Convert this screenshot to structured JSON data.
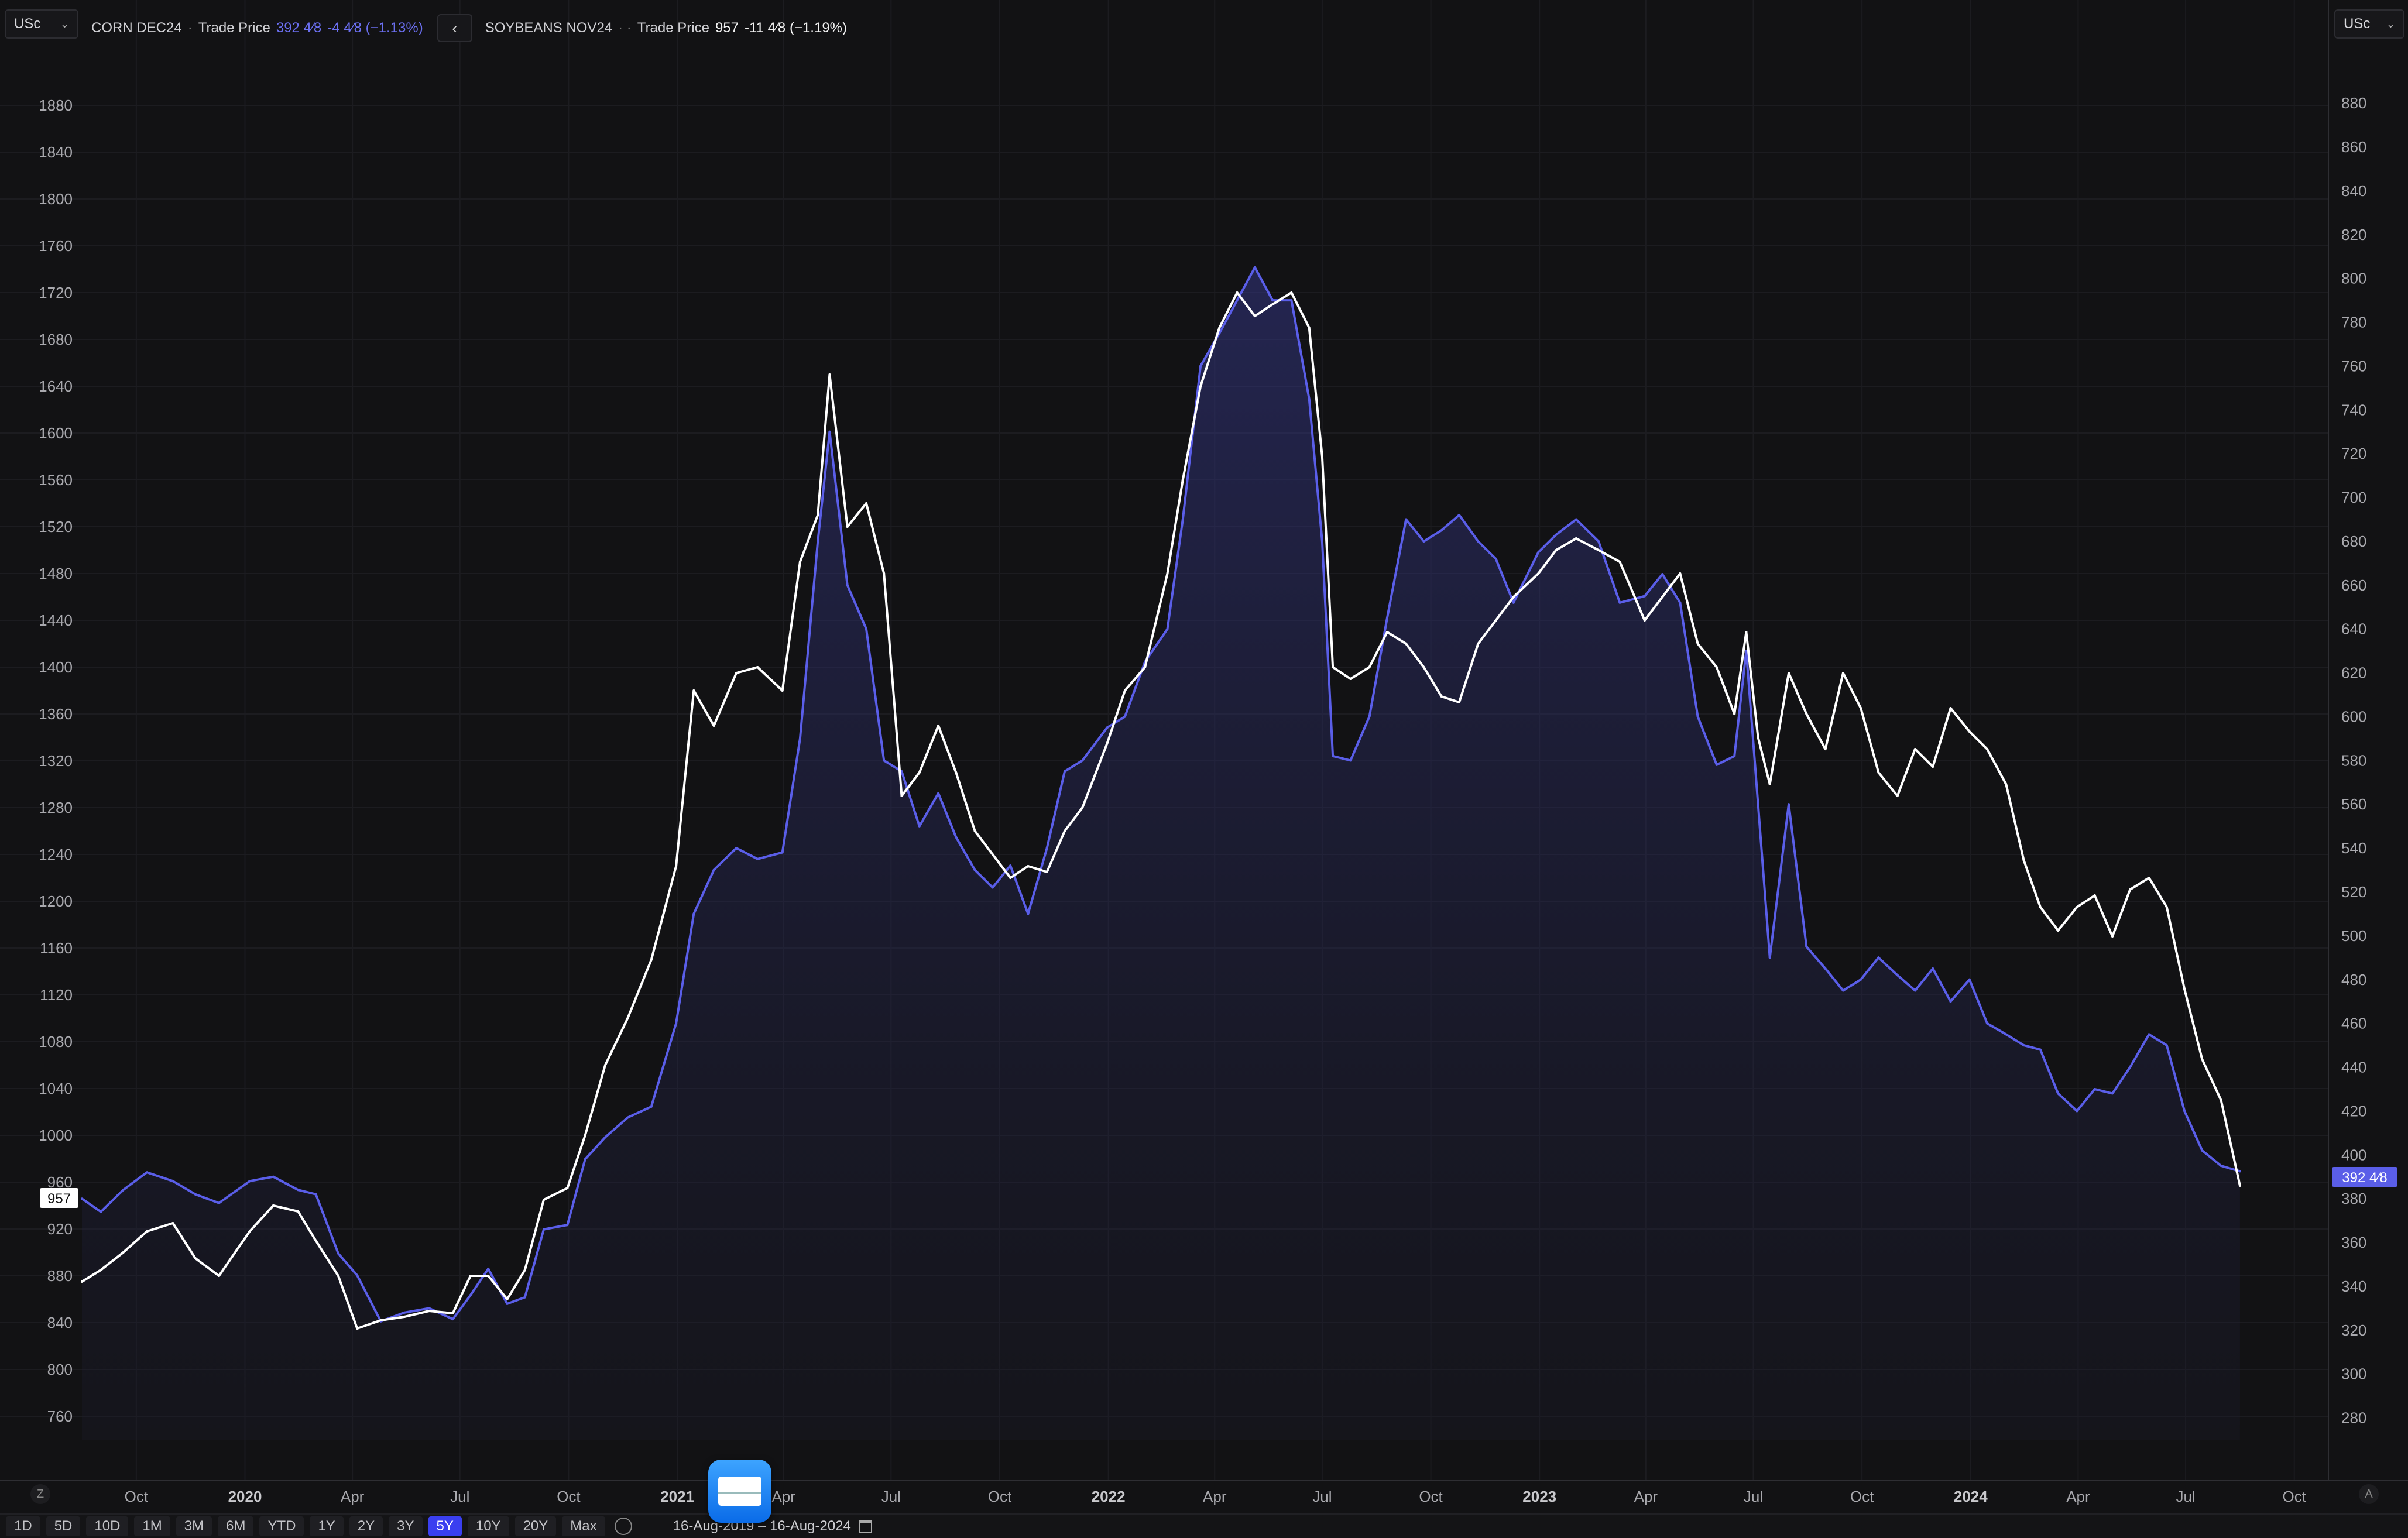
{
  "header": {
    "currency_left": "USc",
    "currency_right": "USc",
    "series1": {
      "name": "CORN DEC24",
      "sep": "·",
      "label": "Trade Price",
      "price": "392 4⁄8",
      "change": "-4 4⁄8 (−1.13%)"
    },
    "series2": {
      "name": "SOYBEANS NOV24",
      "sep": "· ·",
      "label": "Trade Price",
      "price": "957",
      "change": "-11 4⁄8 (−1.19%)"
    }
  },
  "price_tags": {
    "soy": "957",
    "corn": "392 4⁄8"
  },
  "bottom": {
    "ranges": [
      "1D",
      "5D",
      "10D",
      "1M",
      "3M",
      "6M",
      "YTD",
      "1Y",
      "2Y",
      "3Y",
      "5Y",
      "10Y",
      "20Y",
      "Max"
    ],
    "active_range": "5Y",
    "date_range": "16-Aug-2019  –  16-Aug-2024",
    "z_label": "Z",
    "a_label": "A"
  },
  "colors": {
    "corn": "#5a5ee8",
    "soy": "#ffffff",
    "active": "#3a3ff0"
  },
  "chart_data": {
    "type": "line",
    "title": "",
    "x_tick_labels": [
      "Oct",
      "2020",
      "Apr",
      "Jul",
      "Oct",
      "2021",
      "Apr",
      "Jul",
      "Oct",
      "2022",
      "Apr",
      "Jul",
      "Oct",
      "2023",
      "Apr",
      "Jul",
      "Oct",
      "2024",
      "Apr",
      "Jul",
      "Oct"
    ],
    "x_tick_dates": [
      "2019-10-01",
      "2020-01-01",
      "2020-04-01",
      "2020-07-01",
      "2020-10-01",
      "2021-01-01",
      "2021-04-01",
      "2021-07-01",
      "2021-10-01",
      "2022-01-01",
      "2022-04-01",
      "2022-07-01",
      "2022-10-01",
      "2023-01-01",
      "2023-04-01",
      "2023-07-01",
      "2023-10-01",
      "2024-01-01",
      "2024-04-01",
      "2024-07-01",
      "2024-10-01"
    ],
    "xlim": [
      "2019-08-16",
      "2024-10-16"
    ],
    "left_axis": {
      "series": "SOYBEANS NOV24",
      "ylim": [
        740,
        1910
      ],
      "ticks": [
        760,
        800,
        840,
        880,
        920,
        960,
        1000,
        1040,
        1080,
        1120,
        1160,
        1200,
        1240,
        1280,
        1320,
        1360,
        1400,
        1440,
        1480,
        1520,
        1560,
        1600,
        1640,
        1680,
        1720,
        1760,
        1800,
        1840,
        1880
      ]
    },
    "right_axis": {
      "series": "CORN DEC24",
      "ylim": [
        270,
        895
      ],
      "ticks": [
        280,
        300,
        320,
        340,
        360,
        380,
        400,
        420,
        440,
        460,
        480,
        500,
        520,
        540,
        560,
        580,
        600,
        620,
        640,
        660,
        680,
        700,
        720,
        740,
        760,
        780,
        800,
        820,
        840,
        860,
        880
      ]
    },
    "series": [
      {
        "name": "CORN DEC24",
        "axis": "right",
        "color": "#5a5ee8",
        "fill": true,
        "points": [
          [
            "2019-08-16",
            380
          ],
          [
            "2019-09-01",
            374
          ],
          [
            "2019-09-20",
            384
          ],
          [
            "2019-10-10",
            392
          ],
          [
            "2019-11-01",
            388
          ],
          [
            "2019-11-20",
            382
          ],
          [
            "2019-12-10",
            378
          ],
          [
            "2020-01-05",
            388
          ],
          [
            "2020-01-25",
            390
          ],
          [
            "2020-02-15",
            384
          ],
          [
            "2020-03-01",
            382
          ],
          [
            "2020-03-20",
            355
          ],
          [
            "2020-04-05",
            345
          ],
          [
            "2020-04-25",
            324
          ],
          [
            "2020-05-15",
            328
          ],
          [
            "2020-06-05",
            330
          ],
          [
            "2020-06-25",
            325
          ],
          [
            "2020-07-10",
            336
          ],
          [
            "2020-07-25",
            348
          ],
          [
            "2020-08-10",
            332
          ],
          [
            "2020-08-25",
            335
          ],
          [
            "2020-09-10",
            366
          ],
          [
            "2020-09-30",
            368
          ],
          [
            "2020-10-15",
            398
          ],
          [
            "2020-11-01",
            408
          ],
          [
            "2020-11-20",
            417
          ],
          [
            "2020-12-10",
            422
          ],
          [
            "2020-12-31",
            460
          ],
          [
            "2021-01-15",
            510
          ],
          [
            "2021-02-01",
            530
          ],
          [
            "2021-02-20",
            540
          ],
          [
            "2021-03-10",
            535
          ],
          [
            "2021-03-31",
            538
          ],
          [
            "2021-04-15",
            590
          ],
          [
            "2021-04-30",
            680
          ],
          [
            "2021-05-10",
            730
          ],
          [
            "2021-05-25",
            660
          ],
          [
            "2021-06-10",
            640
          ],
          [
            "2021-06-25",
            580
          ],
          [
            "2021-07-10",
            575
          ],
          [
            "2021-07-25",
            550
          ],
          [
            "2021-08-10",
            565
          ],
          [
            "2021-08-25",
            545
          ],
          [
            "2021-09-10",
            530
          ],
          [
            "2021-09-25",
            522
          ],
          [
            "2021-10-10",
            532
          ],
          [
            "2021-10-25",
            510
          ],
          [
            "2021-11-10",
            540
          ],
          [
            "2021-11-25",
            575
          ],
          [
            "2021-12-10",
            580
          ],
          [
            "2021-12-31",
            595
          ],
          [
            "2022-01-15",
            600
          ],
          [
            "2022-02-01",
            625
          ],
          [
            "2022-02-20",
            640
          ],
          [
            "2022-03-05",
            690
          ],
          [
            "2022-03-20",
            760
          ],
          [
            "2022-04-05",
            775
          ],
          [
            "2022-04-20",
            790
          ],
          [
            "2022-05-05",
            805
          ],
          [
            "2022-05-20",
            790
          ],
          [
            "2022-06-05",
            790
          ],
          [
            "2022-06-20",
            745
          ],
          [
            "2022-07-01",
            680
          ],
          [
            "2022-07-10",
            582
          ],
          [
            "2022-07-25",
            580
          ],
          [
            "2022-08-10",
            600
          ],
          [
            "2022-08-25",
            645
          ],
          [
            "2022-09-10",
            690
          ],
          [
            "2022-09-25",
            680
          ],
          [
            "2022-10-10",
            685
          ],
          [
            "2022-10-25",
            692
          ],
          [
            "2022-11-10",
            680
          ],
          [
            "2022-11-25",
            672
          ],
          [
            "2022-12-10",
            652
          ],
          [
            "2022-12-31",
            675
          ],
          [
            "2023-01-15",
            683
          ],
          [
            "2023-02-01",
            690
          ],
          [
            "2023-02-20",
            680
          ],
          [
            "2023-03-10",
            652
          ],
          [
            "2023-03-31",
            655
          ],
          [
            "2023-04-15",
            665
          ],
          [
            "2023-04-30",
            652
          ],
          [
            "2023-05-15",
            600
          ],
          [
            "2023-05-31",
            578
          ],
          [
            "2023-06-15",
            582
          ],
          [
            "2023-06-25",
            630
          ],
          [
            "2023-07-05",
            560
          ],
          [
            "2023-07-15",
            490
          ],
          [
            "2023-07-31",
            560
          ],
          [
            "2023-08-15",
            495
          ],
          [
            "2023-08-31",
            485
          ],
          [
            "2023-09-15",
            475
          ],
          [
            "2023-09-30",
            480
          ],
          [
            "2023-10-15",
            490
          ],
          [
            "2023-10-31",
            482
          ],
          [
            "2023-11-15",
            475
          ],
          [
            "2023-11-30",
            485
          ],
          [
            "2023-12-15",
            470
          ],
          [
            "2023-12-31",
            480
          ],
          [
            "2024-01-15",
            460
          ],
          [
            "2024-01-31",
            455
          ],
          [
            "2024-02-15",
            450
          ],
          [
            "2024-02-29",
            448
          ],
          [
            "2024-03-15",
            428
          ],
          [
            "2024-03-31",
            420
          ],
          [
            "2024-04-15",
            430
          ],
          [
            "2024-04-30",
            428
          ],
          [
            "2024-05-15",
            440
          ],
          [
            "2024-05-31",
            455
          ],
          [
            "2024-06-15",
            450
          ],
          [
            "2024-06-30",
            420
          ],
          [
            "2024-07-15",
            402
          ],
          [
            "2024-07-31",
            395
          ],
          [
            "2024-08-16",
            392.5
          ]
        ]
      },
      {
        "name": "SOYBEANS NOV24",
        "axis": "left",
        "color": "#ffffff",
        "fill": false,
        "points": [
          [
            "2019-08-16",
            875
          ],
          [
            "2019-09-01",
            885
          ],
          [
            "2019-09-20",
            900
          ],
          [
            "2019-10-10",
            918
          ],
          [
            "2019-11-01",
            925
          ],
          [
            "2019-11-20",
            895
          ],
          [
            "2019-12-10",
            880
          ],
          [
            "2020-01-05",
            918
          ],
          [
            "2020-01-25",
            940
          ],
          [
            "2020-02-15",
            935
          ],
          [
            "2020-03-01",
            910
          ],
          [
            "2020-03-20",
            880
          ],
          [
            "2020-04-05",
            835
          ],
          [
            "2020-04-25",
            842
          ],
          [
            "2020-05-15",
            845
          ],
          [
            "2020-06-05",
            850
          ],
          [
            "2020-06-25",
            848
          ],
          [
            "2020-07-10",
            880
          ],
          [
            "2020-07-25",
            880
          ],
          [
            "2020-08-10",
            860
          ],
          [
            "2020-08-25",
            885
          ],
          [
            "2020-09-10",
            945
          ],
          [
            "2020-09-30",
            955
          ],
          [
            "2020-10-15",
            1000
          ],
          [
            "2020-11-01",
            1060
          ],
          [
            "2020-11-20",
            1100
          ],
          [
            "2020-12-10",
            1150
          ],
          [
            "2020-12-31",
            1230
          ],
          [
            "2021-01-15",
            1380
          ],
          [
            "2021-02-01",
            1350
          ],
          [
            "2021-02-20",
            1395
          ],
          [
            "2021-03-10",
            1400
          ],
          [
            "2021-03-31",
            1380
          ],
          [
            "2021-04-15",
            1490
          ],
          [
            "2021-04-30",
            1530
          ],
          [
            "2021-05-10",
            1650
          ],
          [
            "2021-05-25",
            1520
          ],
          [
            "2021-06-10",
            1540
          ],
          [
            "2021-06-25",
            1480
          ],
          [
            "2021-07-10",
            1290
          ],
          [
            "2021-07-25",
            1310
          ],
          [
            "2021-08-10",
            1350
          ],
          [
            "2021-08-25",
            1310
          ],
          [
            "2021-09-10",
            1260
          ],
          [
            "2021-09-25",
            1240
          ],
          [
            "2021-10-10",
            1220
          ],
          [
            "2021-10-25",
            1230
          ],
          [
            "2021-11-10",
            1225
          ],
          [
            "2021-11-25",
            1260
          ],
          [
            "2021-12-10",
            1280
          ],
          [
            "2021-12-31",
            1335
          ],
          [
            "2022-01-15",
            1380
          ],
          [
            "2022-02-01",
            1400
          ],
          [
            "2022-02-20",
            1480
          ],
          [
            "2022-03-05",
            1560
          ],
          [
            "2022-03-20",
            1640
          ],
          [
            "2022-04-05",
            1690
          ],
          [
            "2022-04-20",
            1720
          ],
          [
            "2022-05-05",
            1700
          ],
          [
            "2022-05-20",
            1710
          ],
          [
            "2022-06-05",
            1720
          ],
          [
            "2022-06-20",
            1690
          ],
          [
            "2022-07-01",
            1580
          ],
          [
            "2022-07-10",
            1400
          ],
          [
            "2022-07-25",
            1390
          ],
          [
            "2022-08-10",
            1400
          ],
          [
            "2022-08-25",
            1430
          ],
          [
            "2022-09-10",
            1420
          ],
          [
            "2022-09-25",
            1400
          ],
          [
            "2022-10-10",
            1375
          ],
          [
            "2022-10-25",
            1370
          ],
          [
            "2022-11-10",
            1420
          ],
          [
            "2022-11-25",
            1440
          ],
          [
            "2022-12-10",
            1460
          ],
          [
            "2022-12-31",
            1480
          ],
          [
            "2023-01-15",
            1500
          ],
          [
            "2023-02-01",
            1510
          ],
          [
            "2023-02-20",
            1500
          ],
          [
            "2023-03-10",
            1490
          ],
          [
            "2023-03-31",
            1440
          ],
          [
            "2023-04-15",
            1460
          ],
          [
            "2023-04-30",
            1480
          ],
          [
            "2023-05-15",
            1420
          ],
          [
            "2023-05-31",
            1400
          ],
          [
            "2023-06-15",
            1360
          ],
          [
            "2023-06-25",
            1430
          ],
          [
            "2023-07-05",
            1340
          ],
          [
            "2023-07-15",
            1300
          ],
          [
            "2023-07-31",
            1395
          ],
          [
            "2023-08-15",
            1360
          ],
          [
            "2023-08-31",
            1330
          ],
          [
            "2023-09-15",
            1395
          ],
          [
            "2023-09-30",
            1365
          ],
          [
            "2023-10-15",
            1310
          ],
          [
            "2023-10-31",
            1290
          ],
          [
            "2023-11-15",
            1330
          ],
          [
            "2023-11-30",
            1315
          ],
          [
            "2023-12-15",
            1365
          ],
          [
            "2023-12-31",
            1345
          ],
          [
            "2024-01-15",
            1330
          ],
          [
            "2024-01-31",
            1300
          ],
          [
            "2024-02-15",
            1235
          ],
          [
            "2024-02-29",
            1195
          ],
          [
            "2024-03-15",
            1175
          ],
          [
            "2024-03-31",
            1195
          ],
          [
            "2024-04-15",
            1205
          ],
          [
            "2024-04-30",
            1170
          ],
          [
            "2024-05-15",
            1210
          ],
          [
            "2024-05-31",
            1220
          ],
          [
            "2024-06-15",
            1195
          ],
          [
            "2024-06-30",
            1125
          ],
          [
            "2024-07-15",
            1065
          ],
          [
            "2024-07-31",
            1030
          ],
          [
            "2024-08-16",
            957
          ]
        ]
      }
    ]
  }
}
